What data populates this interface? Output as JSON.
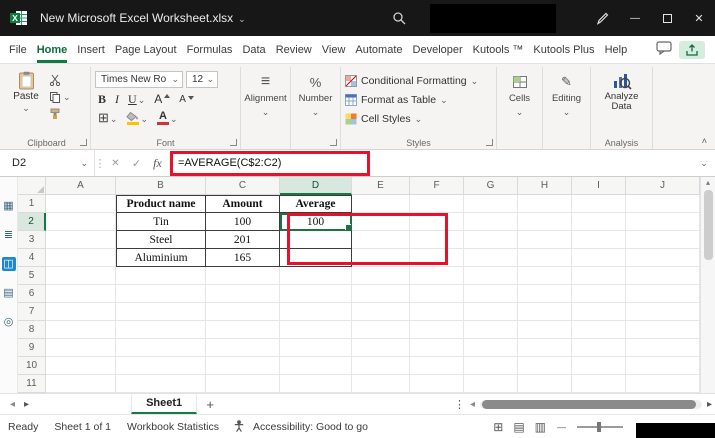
{
  "colors": {
    "accent_green": "#107c41",
    "annotation_red": "#e8112d",
    "titlebar_bg": "#171717"
  },
  "titlebar": {
    "title": "New Microsoft Excel Worksheet.xlsx"
  },
  "menu": {
    "tabs": [
      "File",
      "Home",
      "Insert",
      "Page Layout",
      "Formulas",
      "Data",
      "Review",
      "View",
      "Automate",
      "Developer",
      "Kutools ™",
      "Kutools Plus",
      "Help"
    ],
    "active_tab": "Home"
  },
  "ribbon": {
    "clipboard": {
      "label": "Clipboard",
      "paste_label": "Paste"
    },
    "font": {
      "label": "Font",
      "font_name": "Times New Ro",
      "font_size": "12",
      "bold": "B",
      "italic": "I",
      "underline": "U",
      "grow_letter": "A",
      "shrink_letter": "A",
      "font_color_letter": "A"
    },
    "alignment": {
      "label": "Alignment"
    },
    "number": {
      "label": "Number",
      "percent": "%"
    },
    "styles": {
      "label": "Styles",
      "conditional": "Conditional Formatting",
      "format_table": "Format as Table",
      "cell_styles": "Cell Styles"
    },
    "cells": {
      "label": "Cells"
    },
    "editing": {
      "label": "Editing"
    },
    "analysis": {
      "label": "Analysis",
      "analyze_data": "Analyze Data"
    }
  },
  "formula_bar": {
    "name_box": "D2",
    "fx": "fx",
    "formula": "=AVERAGE(C$2:C2)"
  },
  "side_strip": {
    "icons": [
      "grid",
      "list",
      "pane",
      "sheet",
      "find"
    ],
    "active_index": 2
  },
  "grid": {
    "columns": [
      "A",
      "B",
      "C",
      "D",
      "E",
      "F",
      "G",
      "H",
      "I",
      "J"
    ],
    "rows": [
      "1",
      "2",
      "3",
      "4",
      "5",
      "6",
      "7",
      "8",
      "9",
      "10",
      "11"
    ],
    "cells": {
      "B1": {
        "t": "Product name",
        "b": true
      },
      "C1": {
        "t": "Amount",
        "b": true
      },
      "D1": {
        "t": "Average",
        "b": true
      },
      "B2": {
        "t": "Tin"
      },
      "C2": {
        "t": "100"
      },
      "D2": {
        "t": "100"
      },
      "B3": {
        "t": "Steel"
      },
      "C3": {
        "t": "201"
      },
      "B4": {
        "t": "Aluminium"
      },
      "C4": {
        "t": "165"
      }
    },
    "selected_cell": "D2",
    "table_region": {
      "col_start": "B",
      "col_end": "D",
      "row_start": 1,
      "row_end": 4
    }
  },
  "sheet_bar": {
    "tabs": [
      {
        "label": "Sheet1",
        "active": true
      }
    ]
  },
  "status_bar": {
    "ready": "Ready",
    "sheet_info": "Sheet 1 of 1",
    "workbook_stats": "Workbook Statistics",
    "accessibility": "Accessibility: Good to go",
    "view_icons": [
      "normal-view",
      "page-layout-view",
      "page-break-preview"
    ]
  }
}
